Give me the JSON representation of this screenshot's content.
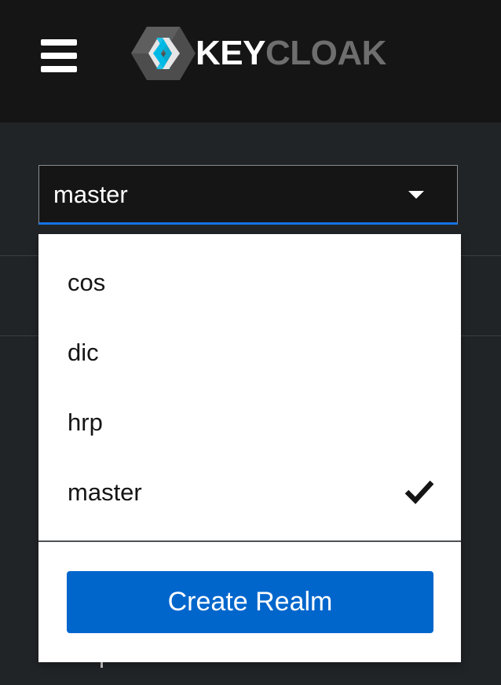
{
  "header": {
    "logo_alt": "Keycloak",
    "logo_text_prefix": "KEY",
    "logo_text_suffix": "CLOAK",
    "menu_icon": "hamburger-menu-icon"
  },
  "realm_selector": {
    "selected": "master",
    "caret_icon": "caret-down-icon",
    "options": [
      {
        "label": "cos",
        "selected": false
      },
      {
        "label": "dic",
        "selected": false
      },
      {
        "label": "hrp",
        "selected": false
      },
      {
        "label": "master",
        "selected": true
      }
    ],
    "selected_icon": "check-icon",
    "create_button_label": "Create Realm"
  },
  "colors": {
    "masthead": "#151515",
    "page_background": "#212427",
    "primary_button": "#0066cc",
    "select_underline": "#1473e6"
  }
}
